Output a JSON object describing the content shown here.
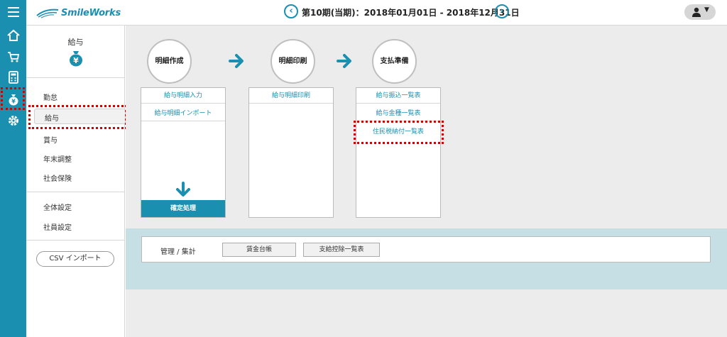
{
  "header": {
    "logo_text": "SmileWorks",
    "period": "第10期(当期)：2018年01月01日 - 2018年12月31日",
    "prev_period_icon": "chevron-left-icon",
    "next_period_icon": "chevron-right-icon",
    "user_menu_caret": "▼"
  },
  "iconbar": {
    "items": [
      "home-icon",
      "cart-icon",
      "calculator-icon",
      "money-bag-icon",
      "gear-icon"
    ],
    "active": "money-bag-icon"
  },
  "sidebar": {
    "title": "給与",
    "items": [
      {
        "label": "勤怠"
      },
      {
        "label": "給与"
      },
      {
        "label": "賞与"
      },
      {
        "label": "年末調整"
      },
      {
        "label": "社会保険"
      },
      {
        "label": "全体設定"
      },
      {
        "label": "社員設定"
      }
    ],
    "csv_import": "CSV インポート"
  },
  "workflow": {
    "steps": [
      {
        "label": "明細作成"
      },
      {
        "label": "明細印刷"
      },
      {
        "label": "支払準備"
      }
    ],
    "panels": [
      {
        "links": [
          "給与明細入力",
          "給与明細インポート"
        ],
        "footer": "確定処理"
      },
      {
        "links": [
          "給与明細印刷"
        ]
      },
      {
        "links": [
          "給与振込一覧表",
          "給与金種一覧表",
          "住民税納付一覧表"
        ]
      }
    ]
  },
  "management": {
    "label": "管理 / 集計",
    "buttons": [
      "賃金台帳",
      "支給控除一覧表"
    ]
  },
  "colors": {
    "accent": "#1a8fb0",
    "highlight": "#d50000",
    "management_band": "#c5dfe5"
  }
}
